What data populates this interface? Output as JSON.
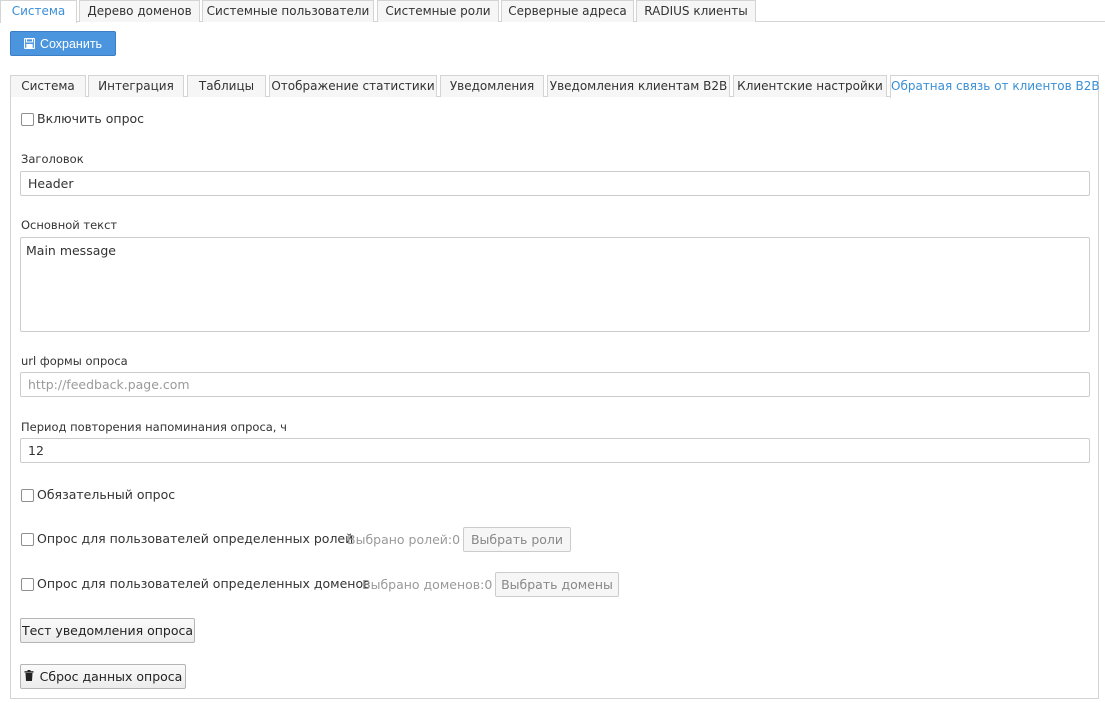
{
  "top_tabs": [
    {
      "label": "Система",
      "active": true
    },
    {
      "label": "Дерево доменов"
    },
    {
      "label": "Системные пользователи"
    },
    {
      "label": "Системные роли"
    },
    {
      "label": "Серверные адреса"
    },
    {
      "label": "RADIUS клиенты"
    }
  ],
  "toolbar": {
    "save_label": "Сохранить",
    "save_icon": "floppy-disk-icon"
  },
  "inner_tabs": [
    {
      "label": "Система"
    },
    {
      "label": "Интеграция"
    },
    {
      "label": "Таблицы"
    },
    {
      "label": "Отображение статистики"
    },
    {
      "label": "Уведомления"
    },
    {
      "label": "Уведомления клиентам B2B"
    },
    {
      "label": "Клиентские настройки"
    },
    {
      "label": "Обратная связь от клиентов B2B",
      "active": true
    }
  ],
  "form": {
    "enable_survey_label": "Включить опрос",
    "header_label": "Заголовок",
    "header_value": "Header",
    "main_text_label": "Основной текст",
    "main_text_value": "Main message",
    "url_label": "url формы опроса",
    "url_placeholder": "http://feedback.page.com",
    "period_label": "Период повторения напоминания опроса, ч",
    "period_value": "12",
    "mandatory_label": "Обязательный опрос",
    "roles_label": "Опрос для пользователей определенных ролей",
    "roles_count": "Выбрано ролей:0",
    "roles_button": "Выбрать роли",
    "domains_label": "Опрос для пользователей определенных доменов",
    "domains_count": "Выбрано доменов:0",
    "domains_button": "Выбрать домены",
    "test_button": "Тест уведомления опроса",
    "reset_button": "Сброс данных опроса",
    "reset_icon": "trash-icon"
  },
  "colors": {
    "accent": "#3a8fd5",
    "primary_button": "#4a95de",
    "border": "#d4d4d4"
  }
}
